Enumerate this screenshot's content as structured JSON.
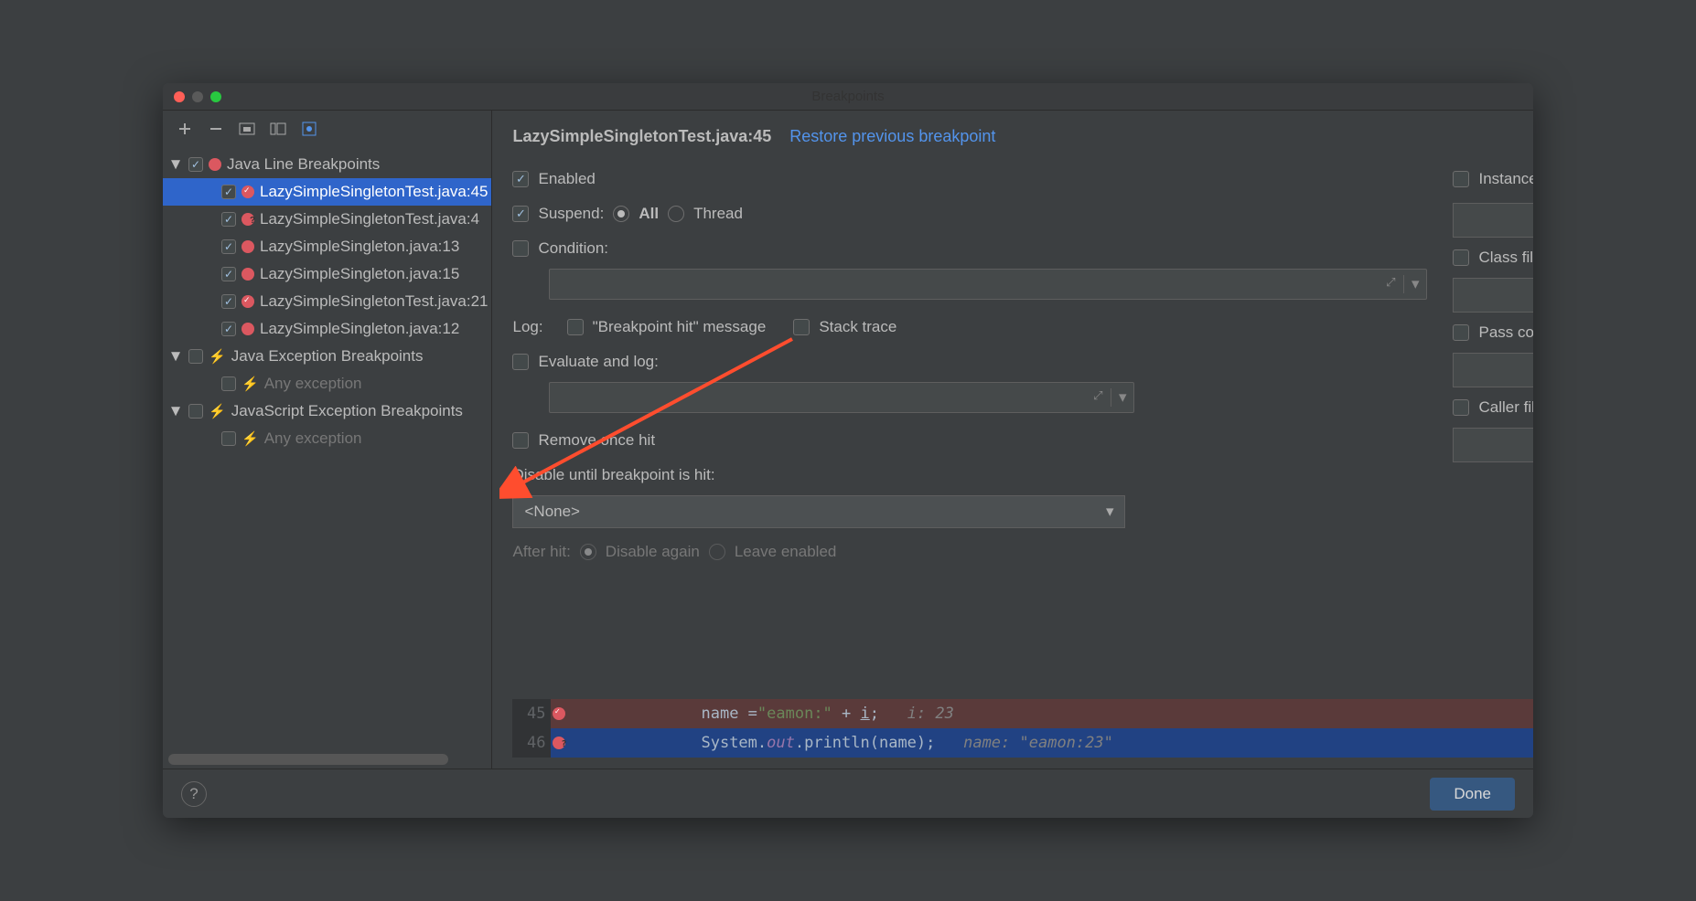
{
  "window": {
    "title": "Breakpoints"
  },
  "sidebar": {
    "groups": [
      {
        "label": "Java Line Breakpoints",
        "checked": true,
        "items": [
          {
            "label": "LazySimpleSingletonTest.java:45",
            "checked": true,
            "selected": true,
            "icon": "tick"
          },
          {
            "label": "LazySimpleSingletonTest.java:4",
            "checked": true,
            "icon": "q"
          },
          {
            "label": "LazySimpleSingleton.java:13",
            "checked": true,
            "icon": "plain"
          },
          {
            "label": "LazySimpleSingleton.java:15",
            "checked": true,
            "icon": "plain"
          },
          {
            "label": "LazySimpleSingletonTest.java:21",
            "checked": true,
            "icon": "tick"
          },
          {
            "label": "LazySimpleSingleton.java:12",
            "checked": true,
            "icon": "plain"
          }
        ]
      },
      {
        "label": "Java Exception Breakpoints",
        "checked": false,
        "bolt": true,
        "items": [
          {
            "label": "Any exception",
            "checked": false,
            "bolt": true,
            "dim": true
          }
        ]
      },
      {
        "label": "JavaScript Exception Breakpoints",
        "checked": false,
        "bolt": true,
        "items": [
          {
            "label": "Any exception",
            "checked": false,
            "bolt": true,
            "dim": true
          }
        ]
      }
    ]
  },
  "details": {
    "title": "LazySimpleSingletonTest.java:45",
    "restore": "Restore previous breakpoint",
    "enabled": "Enabled",
    "suspend": "Suspend:",
    "suspend_all": "All",
    "suspend_thread": "Thread",
    "condition": "Condition:",
    "log": "Log:",
    "log_bp_hit": "\"Breakpoint hit\" message",
    "log_stacktrace": "Stack trace",
    "evaluate_log": "Evaluate and log:",
    "remove_once": "Remove once hit",
    "disable_until": "Disable until breakpoint is hit:",
    "disable_until_value": "<None>",
    "after_hit": "After hit:",
    "after_hit_disable": "Disable again",
    "after_hit_leave": "Leave enabled",
    "instance_filters": "Instance filters:",
    "class_filters": "Class filters:",
    "pass_count": "Pass count:",
    "caller_filters": "Caller filters:"
  },
  "code": {
    "ln45": "45",
    "ln46": "46",
    "line45_pre": "name =",
    "line45_str": "\"eamon:\"",
    "line45_mid": " + ",
    "line45_var": "i",
    "line45_post": ";",
    "line45_cmt": "   i: 23",
    "line46_pre": "System.",
    "line46_out": "out",
    "line46_call": ".println(name);",
    "line46_cmt": "   name: \"eamon:23\""
  },
  "footer": {
    "done": "Done"
  }
}
